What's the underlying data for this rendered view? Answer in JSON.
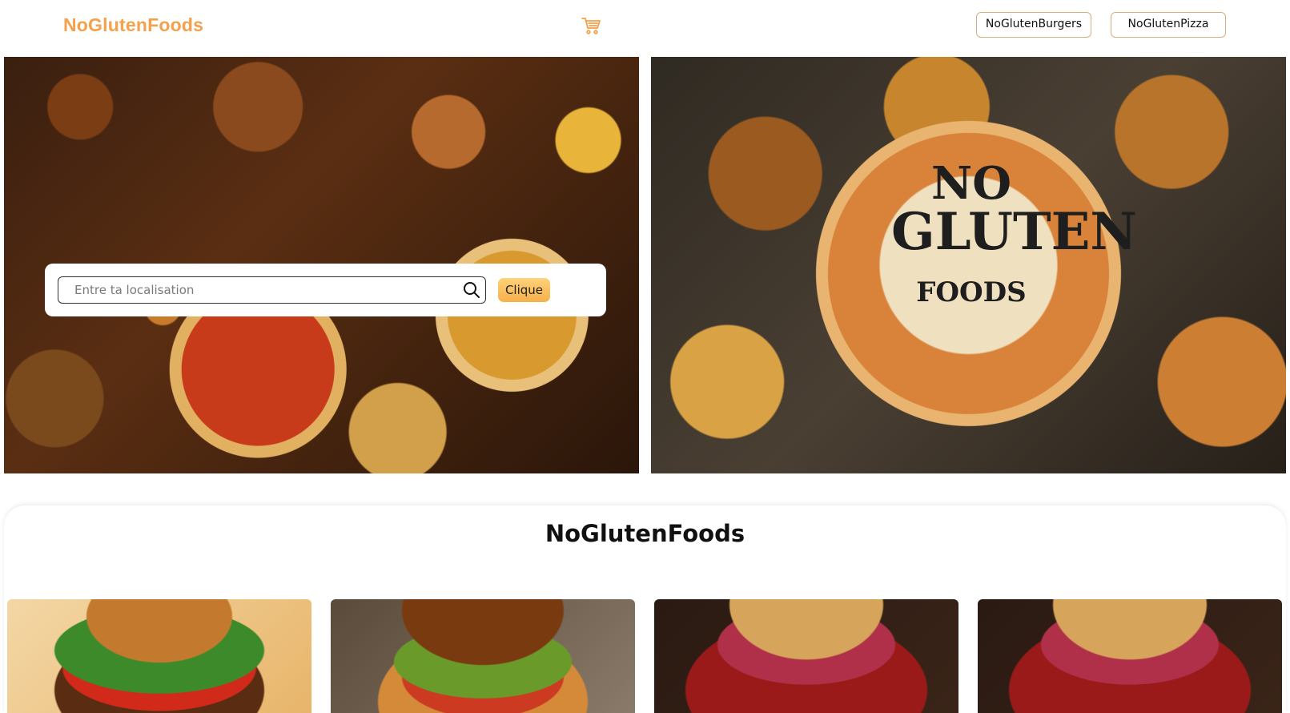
{
  "navbar": {
    "brand": "NoGlutenFoods",
    "cart_icon": "cart-icon",
    "links": [
      {
        "label": "NoGlutenBurgers"
      },
      {
        "label": "NoGlutenPizza"
      }
    ]
  },
  "hero": {
    "left_image": "food-feast-image",
    "right_image": "no-gluten-foods-logo-image",
    "logo_lines": [
      "NO",
      "GLUTEN",
      "FOODS"
    ]
  },
  "search": {
    "placeholder": "Entre ta localisation",
    "value": "",
    "search_icon": "search-icon",
    "button_label": "Clique"
  },
  "section": {
    "title": "NoGlutenFoods",
    "cards": [
      {
        "image": "burger-image"
      },
      {
        "image": "chicken-burger-image"
      },
      {
        "image": "red-burger-image"
      },
      {
        "image": "red-burger-image"
      }
    ]
  },
  "colors": {
    "brand": "#f5a04a",
    "button_border": "#d9b078",
    "clique_button": "#f6b04a"
  }
}
